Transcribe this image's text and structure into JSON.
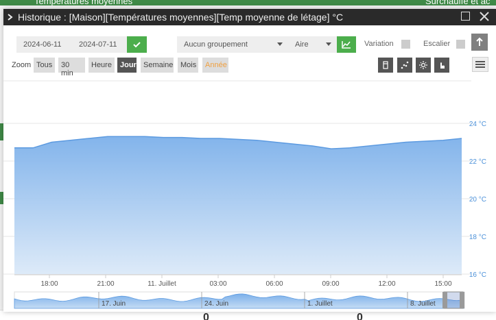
{
  "background": {
    "tab_left": "Températures moyennes",
    "tab_right": "Surchauffe et ac",
    "bottom_values": [
      "0",
      "0"
    ]
  },
  "dialog": {
    "title": "Historique : [Maison][Températures moyennes][Temp moyenne de létage] °C"
  },
  "toolbar": {
    "start_date": "2024-06-11",
    "end_date": "2024-07-11",
    "grouping": "Aucun groupement",
    "chart_type": "Aire",
    "variation_label": "Variation",
    "stairs_label": "Escalier",
    "zoom_label": "Zoom",
    "zoom_buttons": [
      "Tous",
      "30 min",
      "Heure",
      "Jour",
      "Semaine",
      "Mois",
      "Année"
    ],
    "zoom_active": "Jour",
    "zoom_disabled": "Année"
  },
  "colors": {
    "accent_green": "#4cae4c",
    "series_fill": "#7cb0ea",
    "series_line": "#5c9ae0",
    "axis_label": "#4a90d9"
  },
  "chart_data": {
    "type": "area",
    "unit": "°C",
    "y_ticks": [
      "24 °C",
      "22 °C",
      "20 °C",
      "18 °C",
      "16 °C"
    ],
    "ylim": [
      16,
      24
    ],
    "x_ticks": [
      "18:00",
      "21:00",
      "11. Juillet",
      "03:00",
      "06:00",
      "09:00",
      "12:00",
      "15:00"
    ],
    "series": [
      {
        "x": [
          "16:00",
          "17:00",
          "18:00",
          "19:00",
          "20:00",
          "21:00",
          "22:00",
          "23:00",
          "00:00",
          "01:00",
          "02:00",
          "03:00",
          "04:00",
          "05:00",
          "06:00",
          "07:00",
          "08:00",
          "09:00",
          "10:00",
          "11:00",
          "12:00",
          "13:00",
          "14:00",
          "15:00",
          "16:00"
        ],
        "values": [
          22.7,
          22.7,
          23.0,
          23.1,
          23.2,
          23.3,
          23.3,
          23.3,
          23.25,
          23.25,
          23.2,
          23.2,
          23.15,
          23.1,
          23.0,
          22.9,
          22.8,
          22.65,
          22.7,
          22.8,
          22.9,
          23.0,
          23.05,
          23.1,
          23.2
        ]
      }
    ],
    "navigator_ticks": [
      "17. Juin",
      "24. Juin",
      "1. Juillet",
      "8. Juillet"
    ]
  }
}
